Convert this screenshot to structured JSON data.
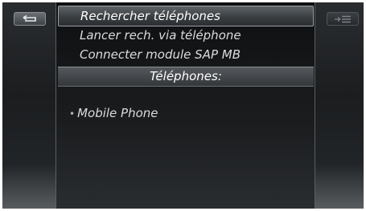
{
  "left_button": {
    "icon": "back-arrow-icon"
  },
  "right_button": {
    "icon": "list-menu-icon"
  },
  "menu": {
    "items": [
      {
        "label": "Rechercher téléphones",
        "selected": true
      },
      {
        "label": "Lancer rech. via téléphone"
      },
      {
        "label": "Connecter module SAP MB"
      }
    ]
  },
  "phones": {
    "heading": "Téléphones:",
    "items": [
      {
        "label": "Mobile Phone"
      }
    ]
  }
}
